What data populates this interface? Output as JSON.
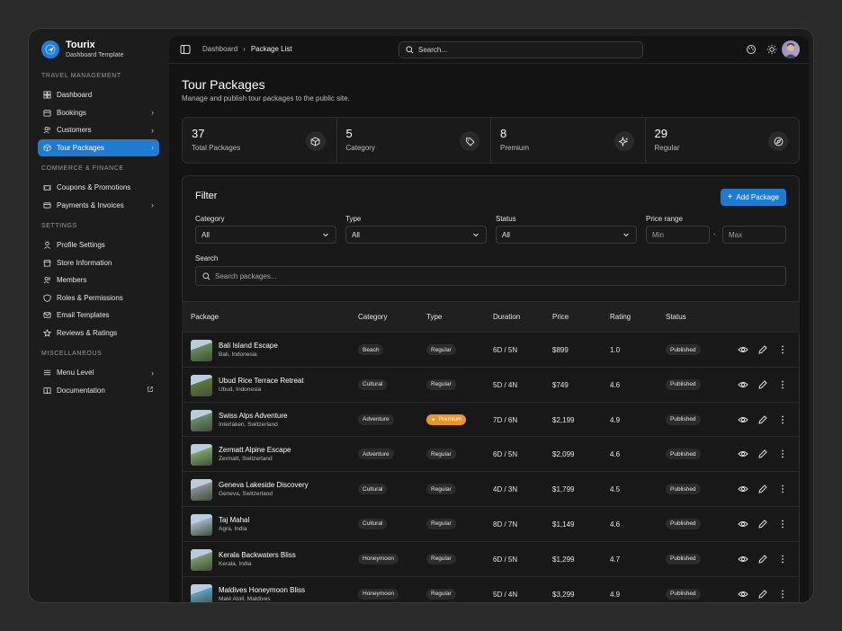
{
  "brand": {
    "name": "Tourix",
    "subtitle": "Dashboard Template"
  },
  "sidebar": {
    "sections": [
      {
        "label": "TRAVEL MANAGEMENT",
        "items": [
          {
            "label": "Dashboard",
            "icon": "grid-icon",
            "chevron": false,
            "active": false
          },
          {
            "label": "Bookings",
            "icon": "calendar-icon",
            "chevron": true,
            "active": false
          },
          {
            "label": "Customers",
            "icon": "users-icon",
            "chevron": true,
            "active": false
          },
          {
            "label": "Tour Packages",
            "icon": "box-icon",
            "chevron": true,
            "active": true
          }
        ]
      },
      {
        "label": "COMMERCE & FINANCE",
        "items": [
          {
            "label": "Coupons & Promotions",
            "icon": "ticket-icon",
            "chevron": false,
            "active": false
          },
          {
            "label": "Payments & Invoices",
            "icon": "credit-card-icon",
            "chevron": true,
            "active": false
          }
        ]
      },
      {
        "label": "SETTINGS",
        "items": [
          {
            "label": "Profile Settings",
            "icon": "user-icon",
            "chevron": false,
            "active": false
          },
          {
            "label": "Store Information",
            "icon": "store-icon",
            "chevron": false,
            "active": false
          },
          {
            "label": "Members",
            "icon": "users-icon",
            "chevron": false,
            "active": false
          },
          {
            "label": "Roles & Permissions",
            "icon": "shield-icon",
            "chevron": false,
            "active": false
          },
          {
            "label": "Email Templates",
            "icon": "mail-icon",
            "chevron": false,
            "active": false
          },
          {
            "label": "Reviews & Ratings",
            "icon": "star-icon",
            "chevron": false,
            "active": false
          }
        ]
      },
      {
        "label": "MISCELLANEOUS",
        "items": [
          {
            "label": "Menu Level",
            "icon": "menu-icon",
            "chevron": true,
            "active": false
          },
          {
            "label": "Documentation",
            "icon": "book-icon",
            "chevron": false,
            "external": true,
            "active": false
          }
        ]
      }
    ]
  },
  "topbar": {
    "breadcrumb": [
      "Dashboard",
      "Package List"
    ],
    "search_placeholder": "Search..."
  },
  "page": {
    "title": "Tour Packages",
    "subtitle": "Manage and publish tour packages to the public site."
  },
  "stats": [
    {
      "value": "37",
      "label": "Total Packages",
      "icon": "box-icon"
    },
    {
      "value": "5",
      "label": "Category",
      "icon": "tag-icon"
    },
    {
      "value": "8",
      "label": "Premium",
      "icon": "sparkles-icon"
    },
    {
      "value": "29",
      "label": "Regular",
      "icon": "compass-icon"
    }
  ],
  "filter": {
    "title": "Filter",
    "add_button": "Add Package",
    "category": {
      "label": "Category",
      "value": "All"
    },
    "type": {
      "label": "Type",
      "value": "All"
    },
    "status": {
      "label": "Status",
      "value": "All"
    },
    "price": {
      "label": "Price range",
      "min_placeholder": "Min",
      "max_placeholder": "Max",
      "separator": "-"
    },
    "search": {
      "label": "Search",
      "placeholder": "Search packages..."
    }
  },
  "table": {
    "headers": [
      "Package",
      "Category",
      "Type",
      "Duration",
      "Price",
      "Rating",
      "Status"
    ],
    "rows": [
      {
        "name": "Bali Island Escape",
        "location": "Bali, Indonesia",
        "category": "Beach",
        "type": "Regular",
        "duration": "6D / 5N",
        "price": "$899",
        "rating": "1.0",
        "status": "Published",
        "thumb": "#6a8a5a"
      },
      {
        "name": "Ubud Rice Terrace Retreat",
        "location": "Ubud, Indonesia",
        "category": "Cultural",
        "type": "Regular",
        "duration": "5D / 4N",
        "price": "$749",
        "rating": "4.6",
        "status": "Published",
        "thumb": "#5d7a3c"
      },
      {
        "name": "Swiss Alps Adventure",
        "location": "Interlaken, Switzerland",
        "category": "Adventure",
        "type": "Premium",
        "duration": "7D / 6N",
        "price": "$2,199",
        "rating": "4.9",
        "status": "Published",
        "thumb": "#6a8c6a"
      },
      {
        "name": "Zermatt Alpine Escape",
        "location": "Zermatt, Switzerland",
        "category": "Adventure",
        "type": "Regular",
        "duration": "6D / 5N",
        "price": "$2,099",
        "rating": "4.6",
        "status": "Published",
        "thumb": "#7fa36a"
      },
      {
        "name": "Geneva Lakeside Discovery",
        "location": "Geneva, Switzerland",
        "category": "Cultural",
        "type": "Regular",
        "duration": "4D / 3N",
        "price": "$1,799",
        "rating": "4.5",
        "status": "Published",
        "thumb": "#8a8f96"
      },
      {
        "name": "Taj Mahal",
        "location": "Agra, India",
        "category": "Cultural",
        "type": "Regular",
        "duration": "8D / 7N",
        "price": "$1,149",
        "rating": "4.6",
        "status": "Published",
        "thumb": "#9fb0c4"
      },
      {
        "name": "Kerala Backwaters Bliss",
        "location": "Kerala, India",
        "category": "Honeymoon",
        "type": "Regular",
        "duration": "6D / 5N",
        "price": "$1,299",
        "rating": "4.7",
        "status": "Published",
        "thumb": "#7a9a6a"
      },
      {
        "name": "Maldives Honeymoon Bliss",
        "location": "Malé Atoll, Maldives",
        "category": "Honeymoon",
        "type": "Regular",
        "duration": "5D / 4N",
        "price": "$3,299",
        "rating": "4.9",
        "status": "Published",
        "thumb": "#5fa0c4"
      }
    ]
  },
  "colors": {
    "accent": "#1e7bcf",
    "premium": "#e8952b"
  }
}
